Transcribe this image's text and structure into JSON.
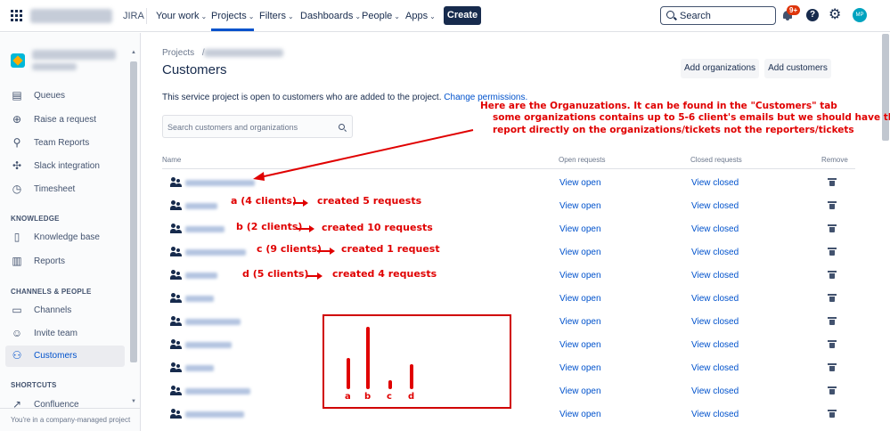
{
  "topnav": {
    "product": "JIRA",
    "items": [
      {
        "label": "Your work"
      },
      {
        "label": "Projects"
      },
      {
        "label": "Filters"
      },
      {
        "label": "Dashboards"
      },
      {
        "label": "People"
      },
      {
        "label": "Apps"
      }
    ],
    "create_label": "Create",
    "search_placeholder": "Search",
    "notification_badge": "9+",
    "avatar_initials": "MP"
  },
  "sidebar": {
    "items": [
      {
        "label": "Queues",
        "icon": "queues-icon"
      },
      {
        "label": "Raise a request",
        "icon": "raise-request-icon"
      },
      {
        "label": "Team Reports",
        "icon": "team-reports-icon"
      },
      {
        "label": "Slack integration",
        "icon": "slack-icon"
      },
      {
        "label": "Timesheet",
        "icon": "timesheet-icon"
      }
    ],
    "knowledge_heading": "KNOWLEDGE",
    "knowledge_items": [
      {
        "label": "Knowledge base",
        "icon": "book-icon"
      },
      {
        "label": "Reports",
        "icon": "chart-icon"
      }
    ],
    "channels_heading": "CHANNELS & PEOPLE",
    "channel_items": [
      {
        "label": "Channels",
        "icon": "monitor-icon"
      },
      {
        "label": "Invite team",
        "icon": "invite-icon"
      },
      {
        "label": "Customers",
        "icon": "customers-icon"
      }
    ],
    "shortcuts_heading": "SHORTCUTS",
    "shortcut_items": [
      {
        "label": "Confluence",
        "icon": "external-link-icon"
      }
    ],
    "footer": "You're in a company-managed project"
  },
  "main": {
    "breadcrumb_root": "Projects",
    "breadcrumb_sep": "/",
    "title": "Customers",
    "add_orgs_label": "Add organizations",
    "add_customers_label": "Add customers",
    "info_text": "This service project is open to customers who are added to the project.",
    "info_link": "Change permissions.",
    "search_placeholder": "Search customers and organizations",
    "columns": {
      "name": "Name",
      "open": "Open requests",
      "closed": "Closed requests",
      "remove": "Remove"
    },
    "rows": [
      {
        "open": "View open",
        "closed": "View closed"
      },
      {
        "open": "View open",
        "closed": "View closed"
      },
      {
        "open": "View open",
        "closed": "View closed"
      },
      {
        "open": "View open",
        "closed": "View closed"
      },
      {
        "open": "View open",
        "closed": "View closed"
      },
      {
        "open": "View open",
        "closed": "View closed"
      },
      {
        "open": "View open",
        "closed": "View closed"
      },
      {
        "open": "View open",
        "closed": "View closed"
      },
      {
        "open": "View open",
        "closed": "View closed"
      },
      {
        "open": "View open",
        "closed": "View closed"
      },
      {
        "open": "View open",
        "closed": "View closed"
      }
    ]
  },
  "annotations": {
    "note_line1": "Here are the Organuzations. It can be found in the \"Customers\" tab",
    "note_line2": "some organizations contains up to 5-6 client's emails but we should have the",
    "note_line3": "report directly on the organizations/tickets not the reporters/tickets",
    "labels": [
      {
        "left": "a (4 clients)",
        "right": "created 5 requests"
      },
      {
        "left": "b (2 clients)",
        "right": "created 10 requests"
      },
      {
        "left": "c (9 clients)",
        "right": "created 1 request"
      },
      {
        "left": "d (5 clients)",
        "right": "created 4 requests"
      }
    ],
    "bars": [
      {
        "label": "a",
        "value": 5
      },
      {
        "label": "b",
        "value": 10
      },
      {
        "label": "c",
        "value": 1
      },
      {
        "label": "d",
        "value": 4
      }
    ],
    "color": "#e00000"
  }
}
